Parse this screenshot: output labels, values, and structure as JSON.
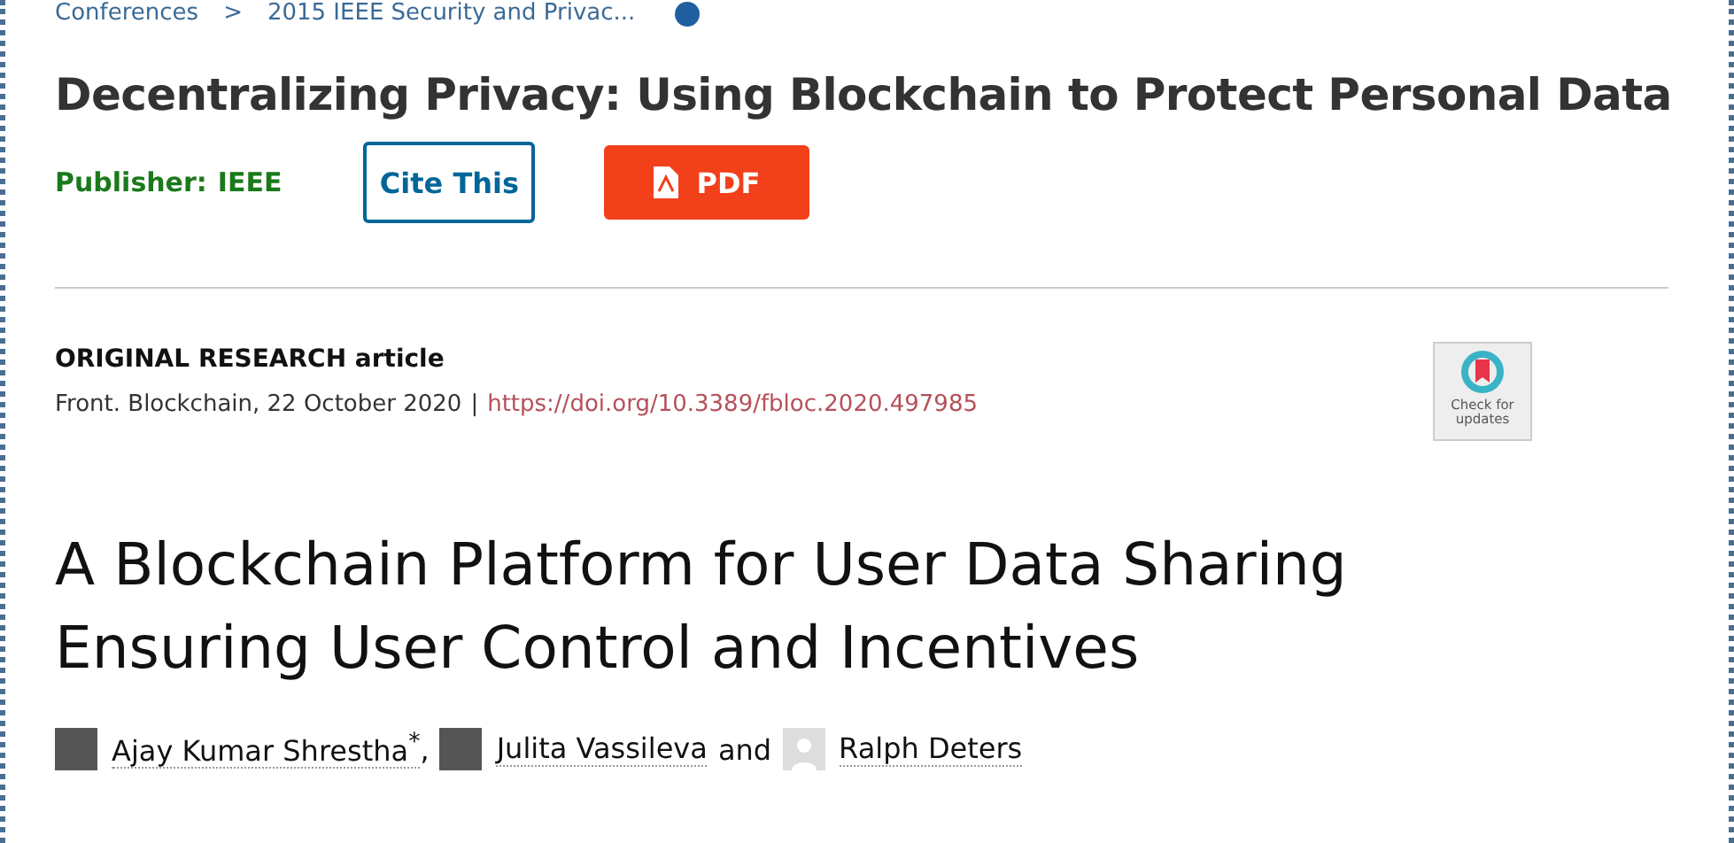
{
  "breadcrumb": {
    "items": [
      "Conferences",
      "2015 IEEE Security and Privac..."
    ],
    "separator": ">"
  },
  "ieee_article": {
    "title": "Decentralizing Privacy: Using Blockchain to Protect Personal Data",
    "publisher_label": "Publisher:",
    "publisher": "IEEE",
    "cite_button": "Cite This",
    "pdf_button": "PDF"
  },
  "frontiers_article": {
    "type": "ORIGINAL RESEARCH article",
    "citation": "Front. Blockchain, 22 October 2020",
    "separator": "|",
    "doi": "https://doi.org/10.3389/fbloc.2020.497985",
    "badge": "Check for updates",
    "title": "A Blockchain Platform for User Data Sharing Ensuring User Control and Incentives",
    "authors": [
      {
        "name": "Ajay Kumar Shrestha$^{*}$",
        "kind": "photo",
        "joiner": ","
      },
      {
        "name": "Julita Vassileva",
        "kind": "photo",
        "joiner": "and"
      },
      {
        "name": "Ralph Deters",
        "kind": "silhouette"
      }
    ]
  }
}
